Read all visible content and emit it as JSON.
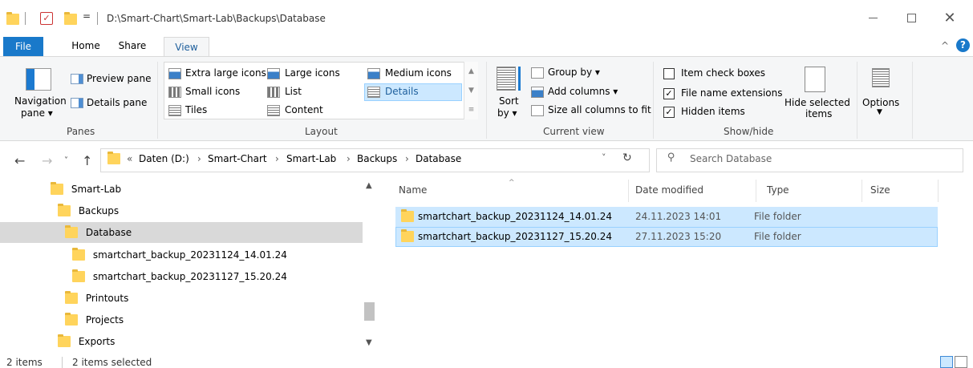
{
  "window": {
    "title_path": "D:\\Smart-Chart\\Smart-Lab\\Backups\\Database",
    "quick_access_dropdown": "=",
    "title_separator": "|"
  },
  "ribbon_tabs": {
    "file": "File",
    "home": "Home",
    "share": "Share",
    "view": "View"
  },
  "ribbon": {
    "panes": {
      "navigation_pane_line1": "Navigation",
      "navigation_pane_line2": "pane",
      "preview_pane": "Preview pane",
      "details_pane": "Details pane",
      "group_label": "Panes"
    },
    "layout": {
      "extra_large_icons": "Extra large icons",
      "large_icons": "Large icons",
      "medium_icons": "Medium icons",
      "small_icons": "Small icons",
      "list": "List",
      "details": "Details",
      "tiles": "Tiles",
      "content": "Content",
      "selected": "Details",
      "group_label": "Layout"
    },
    "current_view": {
      "sort_by_line1": "Sort",
      "sort_by_line2": "by",
      "group_by": "Group by",
      "add_columns": "Add columns",
      "size_all_columns": "Size all columns to fit",
      "group_label": "Current view"
    },
    "show_hide": {
      "item_check_boxes": "Item check boxes",
      "item_check_boxes_checked": false,
      "file_name_extensions": "File name extensions",
      "file_name_extensions_checked": true,
      "hidden_items": "Hidden items",
      "hidden_items_checked": true,
      "hide_selected_items_line1": "Hide selected",
      "hide_selected_items_line2": "items",
      "group_label": "Show/hide"
    },
    "options": "Options"
  },
  "address_bar": {
    "overflow": "«",
    "crumbs": [
      "Daten (D:)",
      "Smart-Chart",
      "Smart-Lab",
      "Backups",
      "Database"
    ],
    "search_placeholder": "Search Database"
  },
  "nav_tree": {
    "items": [
      {
        "label": "Smart-Lab",
        "selected": false
      },
      {
        "label": "Backups",
        "selected": false
      },
      {
        "label": "Database",
        "selected": true
      },
      {
        "label": "smartchart_backup_20231124_14.01.24",
        "selected": false
      },
      {
        "label": "smartchart_backup_20231127_15.20.24",
        "selected": false
      },
      {
        "label": "Printouts",
        "selected": false
      },
      {
        "label": "Projects",
        "selected": false
      },
      {
        "label": "Exports",
        "selected": false
      }
    ]
  },
  "file_list": {
    "columns": {
      "name": "Name",
      "date_modified": "Date modified",
      "type": "Type",
      "size": "Size"
    },
    "rows": [
      {
        "name": "smartchart_backup_20231124_14.01.24",
        "date_modified": "24.11.2023 14:01",
        "type": "File folder",
        "size": "",
        "selected": true
      },
      {
        "name": "smartchart_backup_20231127_15.20.24",
        "date_modified": "27.11.2023 15:20",
        "type": "File folder",
        "size": "",
        "selected": true
      }
    ]
  },
  "status_bar": {
    "item_count": "2 items",
    "selection": "2 items selected",
    "active_view": "details"
  },
  "colors": {
    "accent": "#1979ca",
    "selection": "#cce8ff",
    "selection_border": "#99d1ff",
    "folder": "#ffd45c"
  }
}
